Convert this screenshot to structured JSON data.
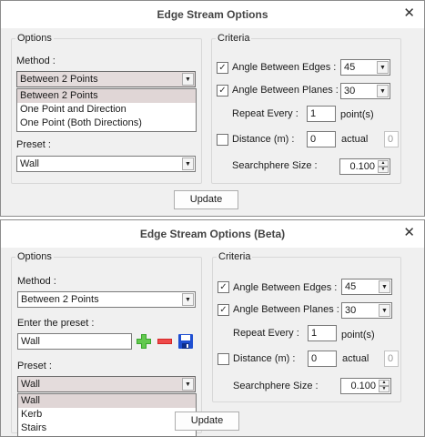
{
  "window1": {
    "title": "Edge Stream Options",
    "options_group": "Options",
    "method_label": "Method :",
    "method_value": "Between 2 Points",
    "method_options": [
      "Between 2 Points",
      "One Point and Direction",
      "One Point (Both Directions)"
    ],
    "preset_label": "Preset :",
    "preset_value": "Wall",
    "criteria_group": "Criteria",
    "angle_edges_label": "Angle Between Edges :",
    "angle_edges_value": "45",
    "angle_edges_checked": true,
    "angle_planes_label": "Angle Between Planes :",
    "angle_planes_value": "30",
    "angle_planes_checked": true,
    "repeat_label": "Repeat Every :",
    "repeat_value": "1",
    "repeat_unit": "point(s)",
    "distance_label": "Distance (m) :",
    "distance_checked": false,
    "distance_value": "0",
    "actual_label": "actual",
    "actual_value": "0",
    "searchsphere_label": "Searchphere Size :",
    "searchsphere_value": "0.100",
    "update_label": "Update"
  },
  "window2": {
    "title": "Edge Stream Options (Beta)",
    "options_group": "Options",
    "method_label": "Method :",
    "method_value": "Between 2 Points",
    "enter_preset_label": "Enter the preset :",
    "enter_preset_value": "Wall",
    "preset_label": "Preset :",
    "preset_value": "Wall",
    "preset_options": [
      "Wall",
      "Kerb",
      "Stairs"
    ],
    "criteria_group": "Criteria",
    "angle_edges_label": "Angle Between Edges :",
    "angle_edges_value": "45",
    "angle_edges_checked": true,
    "angle_planes_label": "Angle Between Planes :",
    "angle_planes_value": "30",
    "angle_planes_checked": true,
    "repeat_label": "Repeat Every :",
    "repeat_value": "1",
    "repeat_unit": "point(s)",
    "distance_label": "Distance (m) :",
    "distance_checked": false,
    "distance_value": "0",
    "actual_label": "actual",
    "actual_value": "0",
    "searchsphere_label": "Searchphere Size :",
    "searchsphere_value": "0.100",
    "update_label": "Update"
  },
  "icons": {
    "close": "close-icon",
    "add": "plus-icon",
    "remove": "minus-icon",
    "save": "save-icon",
    "dropdown": "chevron-down-icon"
  },
  "colors": {
    "window_bg": "#f0f0f0",
    "add_icon": "#3aa62e",
    "remove_icon": "#d42626",
    "save_icon": "#1f4fd1",
    "selected_item": "#e0d6d6"
  }
}
